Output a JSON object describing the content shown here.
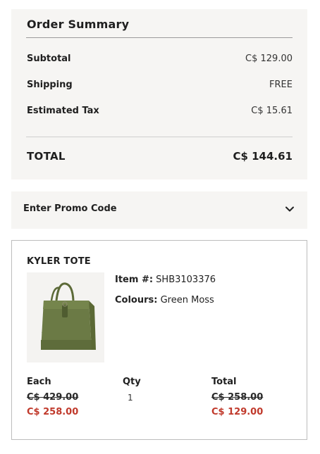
{
  "order_summary": {
    "title": "Order Summary",
    "rows": [
      {
        "label": "Subtotal",
        "value": "C$ 129.00"
      },
      {
        "label": "Shipping",
        "value": "FREE"
      },
      {
        "label": "Estimated Tax",
        "value": "C$ 15.61"
      }
    ],
    "total_label": "TOTAL",
    "total_value": "C$ 144.61"
  },
  "promo": {
    "label": "Enter Promo Code",
    "icon": "chevron-down-icon"
  },
  "product": {
    "name": "KYLER TOTE",
    "item_label": "Item #:",
    "item_number": "SHB3103376",
    "colour_label": "Colours:",
    "colour_value": "Green Moss",
    "image_icon": "green-tote-bag",
    "columns": {
      "each": "Each",
      "qty": "Qty",
      "total": "Total"
    },
    "each_original": "C$ 429.00",
    "each_sale": "C$ 258.00",
    "qty": "1",
    "total_original": "C$ 258.00",
    "total_sale": "C$ 129.00",
    "colors": {
      "sale_red": "#c0392b",
      "bag_green": "#6b7a45"
    }
  }
}
